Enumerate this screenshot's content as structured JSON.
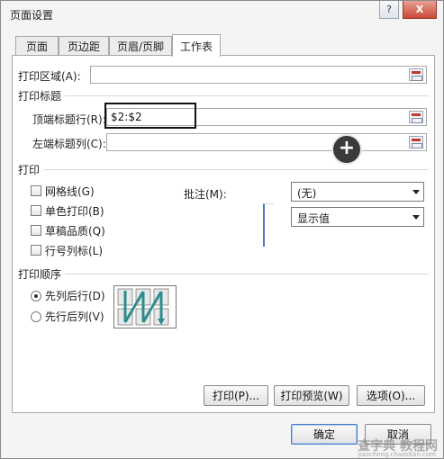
{
  "window": {
    "title": "页面设置",
    "help": "?",
    "close": "X"
  },
  "tabs": [
    "页面",
    "页边距",
    "页眉/页脚",
    "工作表"
  ],
  "print_area": {
    "label": "打印区域(A):",
    "value": ""
  },
  "print_titles": {
    "section": "打印标题",
    "rows_label": "顶端标题行(R):",
    "rows_value": "$2:$2",
    "cols_label": "左端标题列(C):",
    "cols_value": ""
  },
  "print": {
    "section": "打印",
    "gridlines": "网格线(G)",
    "mono": "单色打印(B)",
    "draft": "草稿品质(Q)",
    "headings": "行号列标(L)",
    "comments_label": "批注(M):",
    "comments_value": "(无)",
    "errors_value": "显示值"
  },
  "page_order": {
    "section": "打印顺序",
    "down_then_over": "先列后行(D)",
    "over_then_down": "先行后列(V)",
    "selected": "先列后行(D)"
  },
  "buttons": {
    "print": "打印(P)...",
    "preview": "打印预览(W)",
    "options": "选项(O)...",
    "ok": "确定",
    "cancel": "取消"
  },
  "watermark": "查字典 教程网",
  "watermark_url": "jiaocheng.chazidian.com",
  "icons": {
    "add": "plus-circle-icon",
    "collapse": "range-select-icon"
  }
}
